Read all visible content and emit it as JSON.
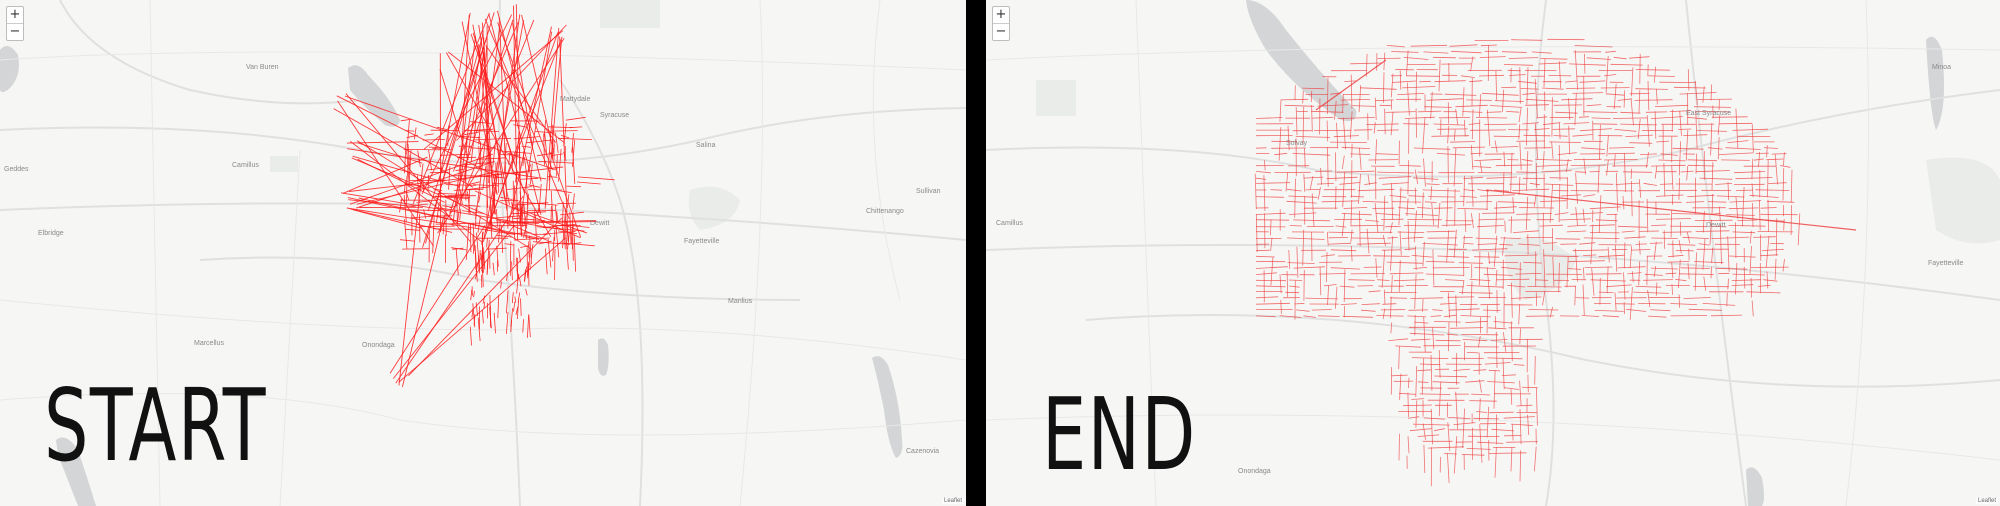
{
  "colors": {
    "route": "#ff1a1a",
    "route_end": "#ef3a3a",
    "water": "#d3d5d6",
    "land": "#f6f6f5",
    "road": "#e2e2e2",
    "park": "#e9ece9"
  },
  "start": {
    "label": "START",
    "zoom_in": "+",
    "zoom_out": "−",
    "attribution": "Leaflet",
    "places": [
      "Van Buren",
      "Camillus",
      "Geddes",
      "Mattydale",
      "Syracuse",
      "Salina",
      "Elbridge",
      "Dewitt",
      "Fayetteville",
      "Manlius",
      "Sullivan",
      "Chittenango",
      "Marcellus",
      "Onondaga",
      "Cazenovia"
    ]
  },
  "end": {
    "label": "END",
    "zoom_in": "+",
    "zoom_out": "−",
    "attribution": "Leaflet",
    "places": [
      "Solvay",
      "East Syracuse",
      "Camillus",
      "Dewitt",
      "Onondaga",
      "Minoa",
      "Fayetteville"
    ]
  }
}
